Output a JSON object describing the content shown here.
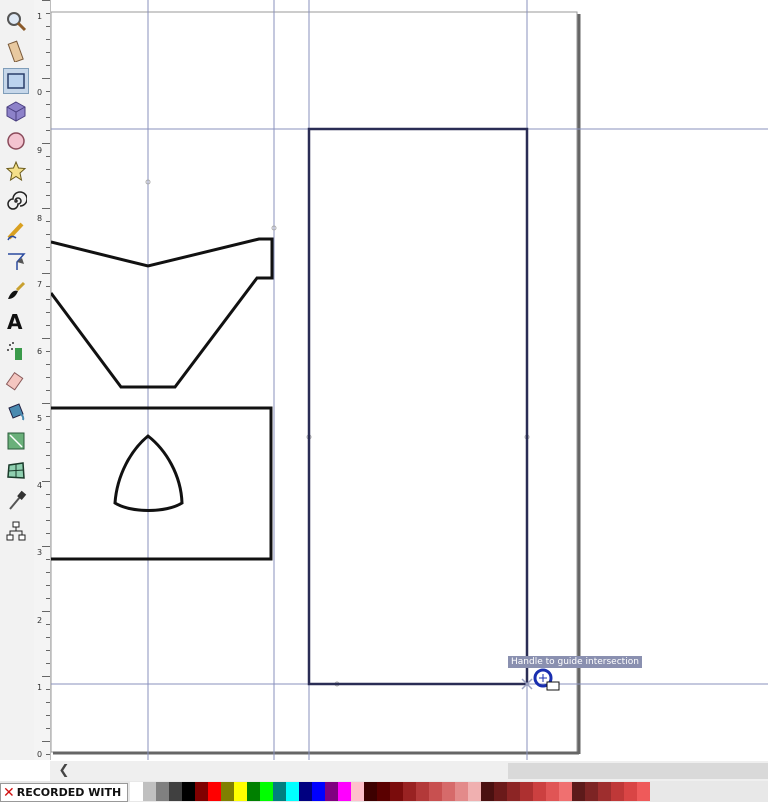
{
  "toolbox": {
    "tools": [
      {
        "name": "zoom-tool",
        "icon": "magnifier-icon"
      },
      {
        "name": "measure-tool",
        "icon": "ruler-icon"
      },
      {
        "name": "rectangle-tool",
        "icon": "rectangle-icon",
        "active": true
      },
      {
        "name": "3d-box-tool",
        "icon": "cube-icon"
      },
      {
        "name": "ellipse-tool",
        "icon": "circle-icon"
      },
      {
        "name": "star-tool",
        "icon": "star-icon"
      },
      {
        "name": "spiral-tool",
        "icon": "spiral-icon"
      },
      {
        "name": "pencil-tool",
        "icon": "pencil-icon"
      },
      {
        "name": "pen-tool",
        "icon": "pen-icon"
      },
      {
        "name": "calligraphy-tool",
        "icon": "calligraphy-icon"
      },
      {
        "name": "text-tool",
        "icon": "text-icon",
        "glyph": "A"
      },
      {
        "name": "spray-tool",
        "icon": "spray-icon"
      },
      {
        "name": "eraser-tool",
        "icon": "eraser-icon"
      },
      {
        "name": "paint-bucket-tool",
        "icon": "bucket-icon"
      },
      {
        "name": "gradient-tool",
        "icon": "gradient-icon"
      },
      {
        "name": "mesh-tool",
        "icon": "mesh-icon"
      },
      {
        "name": "dropper-tool",
        "icon": "dropper-icon"
      },
      {
        "name": "connector-tool",
        "icon": "connector-icon"
      }
    ]
  },
  "ruler": {
    "labels": [
      "1",
      "0",
      "9",
      "8",
      "7",
      "6",
      "5",
      "4",
      "3",
      "2",
      "1",
      "0"
    ]
  },
  "canvas": {
    "tooltip": "Handle to guide intersection"
  },
  "palette": {
    "colors": [
      "#ffffff",
      "#c0c0c0",
      "#808080",
      "#404040",
      "#000000",
      "#800000",
      "#ff0000",
      "#808000",
      "#ffff00",
      "#008000",
      "#00ff00",
      "#008080",
      "#00ffff",
      "#000080",
      "#0000ff",
      "#800080",
      "#ff00ff",
      "#ffc0cb",
      "#3d0000",
      "#5a0000",
      "#7a0c0c",
      "#992222",
      "#b33939",
      "#c85050",
      "#d66a6a",
      "#e38a8a",
      "#f0b0b0",
      "#4a1010",
      "#6b1a1a",
      "#8c2525",
      "#ad3030",
      "#cc4040",
      "#e05555",
      "#f07070",
      "#5c1a1a",
      "#7d2424",
      "#9e2e2e",
      "#bf3838",
      "#d94545",
      "#ef5a5a"
    ]
  },
  "watermark": {
    "text": "RECORDED WITH"
  }
}
